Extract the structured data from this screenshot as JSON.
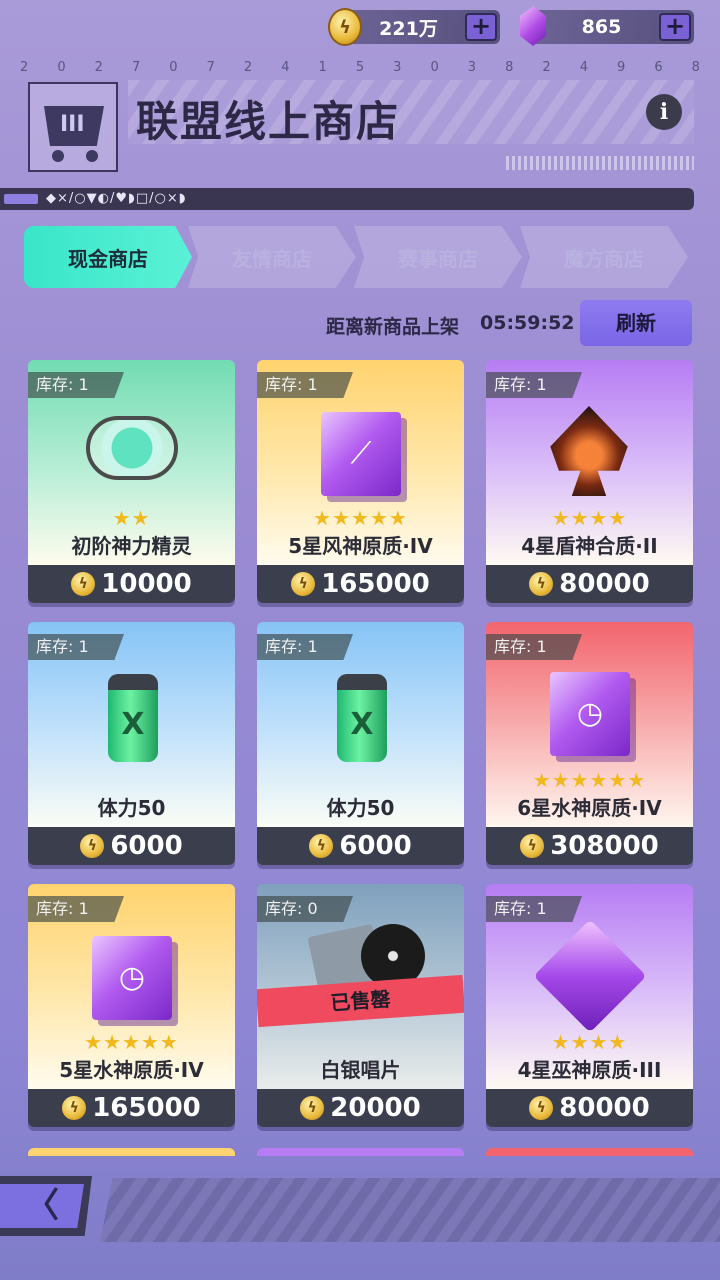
{
  "currency": {
    "coin_value": "221万",
    "gem_value": "865",
    "coin_icon": "lightning-coin-icon",
    "gem_icon": "purple-gem-icon",
    "plus_label": "+"
  },
  "header": {
    "serial_digits": [
      "2",
      "0",
      "2",
      "7",
      "0",
      "7",
      "2",
      "4",
      "1",
      "5",
      "3",
      "0",
      "3",
      "8",
      "2",
      "4",
      "9",
      "6",
      "8"
    ],
    "title": "联盟线上商店",
    "info_label": "i",
    "code_strip": "◆×/○▼◐/♥◗□/○×◗"
  },
  "tabs": [
    {
      "label": "现金商店",
      "active": true
    },
    {
      "label": "友情商店",
      "active": false
    },
    {
      "label": "赛事商店",
      "active": false
    },
    {
      "label": "魔方商店",
      "active": false
    }
  ],
  "timer": {
    "label": "距离新商品上架",
    "value": "05:59:52",
    "refresh_label": "刷新"
  },
  "items": [
    {
      "stock": "库存: 1",
      "stars": "★★",
      "name": "初阶神力精灵",
      "price": "10000",
      "theme": "green",
      "art": "spirit"
    },
    {
      "stock": "库存: 1",
      "stars": "★★★★★",
      "name": "5星风神原质·IV",
      "price": "165000",
      "theme": "yellow",
      "art": "wing-cube"
    },
    {
      "stock": "库存: 1",
      "stars": "★★★★",
      "name": "4星盾神合质·II",
      "price": "80000",
      "theme": "purple",
      "art": "spade"
    },
    {
      "stock": "库存: 1",
      "stars": "",
      "name": "体力50",
      "price": "6000",
      "theme": "blue",
      "art": "can"
    },
    {
      "stock": "库存: 1",
      "stars": "",
      "name": "体力50",
      "price": "6000",
      "theme": "blue",
      "art": "can"
    },
    {
      "stock": "库存: 1",
      "stars": "★★★★★★",
      "name": "6星水神原质·IV",
      "price": "308000",
      "theme": "red",
      "art": "timer-cube"
    },
    {
      "stock": "库存: 1",
      "stars": "★★★★★",
      "name": "5星水神原质·IV",
      "price": "165000",
      "theme": "yellow",
      "art": "timer-cube"
    },
    {
      "stock": "库存: 0",
      "stars": "",
      "name": "白银唱片",
      "price": "20000",
      "theme": "grey",
      "art": "disc",
      "soldout": "已售罄"
    },
    {
      "stock": "库存: 1",
      "stars": "★★★★",
      "name": "4星巫神原质·III",
      "price": "80000",
      "theme": "purple",
      "art": "gem"
    }
  ],
  "nav": {
    "back_label": "〈"
  },
  "colors": {
    "accent_tab": "#39e6c8",
    "refresh_btn": "#8e7bf0",
    "soldout": "#f04a5f",
    "price_bar": "#3b3f4d"
  }
}
